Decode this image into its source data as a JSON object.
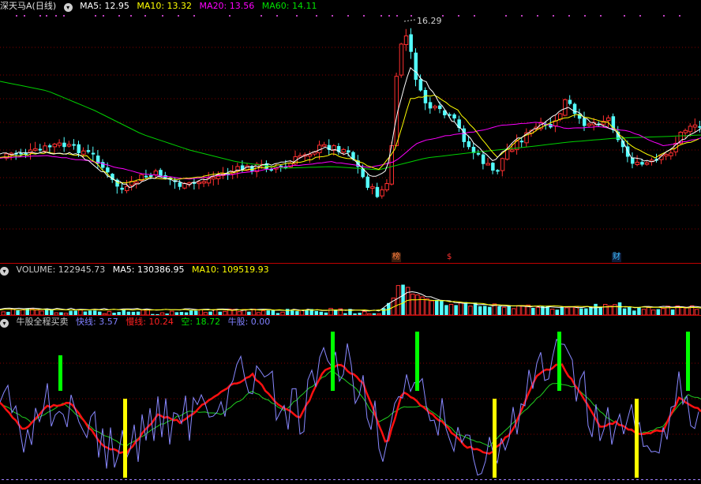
{
  "main": {
    "title": "深天马A(日线)",
    "ma_labels": [
      {
        "text": "MA5: 12.95",
        "color": "#ffffff"
      },
      {
        "text": "MA10: 13.32",
        "color": "#ffff00"
      },
      {
        "text": "MA20: 13.56",
        "color": "#ff00ff"
      },
      {
        "text": "MA60: 14.11",
        "color": "#00e000"
      }
    ],
    "peak_label": "16.29",
    "markers": [
      {
        "text": "榜",
        "color": "#ff8040",
        "bg": "#402010"
      },
      {
        "text": "$",
        "color": "#ff3030",
        "bg": "transparent"
      },
      {
        "text": "财",
        "color": "#40c0ff",
        "bg": "#102040"
      }
    ],
    "colors": {
      "up": "#ff3030",
      "down": "#54ffff"
    }
  },
  "volume": {
    "labels": [
      {
        "text": "VOLUME: 122945.73",
        "color": "#c8c8c8"
      },
      {
        "text": "MA5: 130386.95",
        "color": "#ffffff"
      },
      {
        "text": "MA10: 109519.93",
        "color": "#ffff00"
      }
    ]
  },
  "indicator": {
    "labels": [
      {
        "text": "牛股全程买卖",
        "color": "#c8c8c8"
      },
      {
        "text": "快线: 3.57",
        "color": "#8080ff"
      },
      {
        "text": "慢线: 10.24",
        "color": "#ff2020"
      },
      {
        "text": "空: 18.72",
        "color": "#00e000"
      },
      {
        "text": "牛股: 0.00",
        "color": "#8080ff"
      }
    ],
    "colors": {
      "fast": "#8888ff",
      "slow": "#ff1010",
      "kong": "#20d020",
      "sell_bar": "#00ff00",
      "buy_bar": "#ffff00"
    }
  }
}
